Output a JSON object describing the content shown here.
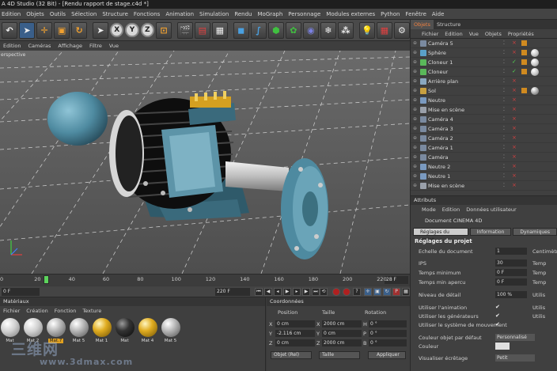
{
  "app": {
    "title": "A 4D Studio (32 Bit) - [Rendu rapport de stage.c4d *]"
  },
  "menubar": [
    "Edition",
    "Objets",
    "Outils",
    "Sélection",
    "Structure",
    "Fonctions",
    "Animation",
    "Simulation",
    "Rendu",
    "MoGraph",
    "Personnage",
    "Modules externes",
    "Python",
    "Fenêtre",
    "Aide"
  ],
  "toolbar": {
    "axes": [
      "X",
      "Y",
      "Z"
    ]
  },
  "viewport": {
    "menu": [
      "Edition",
      "Caméras",
      "Affichage",
      "Filtre",
      "Vue"
    ],
    "label": "erspective"
  },
  "timeline": {
    "ticks": [
      "0",
      "20",
      "40",
      "60",
      "80",
      "100",
      "120",
      "140",
      "160",
      "180",
      "200",
      "220"
    ],
    "current_frame": "28 F",
    "start_field": "0 F",
    "end_field": "220 F"
  },
  "materials": {
    "title": "Matériaux",
    "menu": [
      "Fichier",
      "Création",
      "Fonction",
      "Texture"
    ],
    "items": [
      {
        "label": "Mat",
        "kind": "white"
      },
      {
        "label": "Mat 2",
        "kind": "white"
      },
      {
        "label": "Mat.7",
        "kind": "grey"
      },
      {
        "label": "Mat 5",
        "kind": "grey"
      },
      {
        "label": "Mat 1",
        "kind": "gold"
      },
      {
        "label": "Mat",
        "kind": "black"
      },
      {
        "label": "Mat 4",
        "kind": "gold"
      },
      {
        "label": "Mat 5",
        "kind": "grey"
      }
    ]
  },
  "coords": {
    "title": "Coordonnées",
    "headers": [
      "Position",
      "Taille",
      "Rotation"
    ],
    "rows": [
      {
        "axis": "X",
        "pos": "0 cm",
        "size_axis": "X",
        "size": "2000 cm",
        "rot_axis": "H",
        "rot": "0 °"
      },
      {
        "axis": "Y",
        "pos": "-2.116 cm",
        "size_axis": "Y",
        "size": "0 cm",
        "rot_axis": "P",
        "rot": "0 °"
      },
      {
        "axis": "Z",
        "pos": "0 cm",
        "size_axis": "Z",
        "size": "2000 cm",
        "rot_axis": "B",
        "rot": "0 °"
      }
    ],
    "mode_select": "Objet (Rel)",
    "size_select": "Taille",
    "apply_button": "Appliquer"
  },
  "objects": {
    "tabs": [
      "Objets",
      "Structure"
    ],
    "menu": [
      "Fichier",
      "Edition",
      "Vue",
      "Objets",
      "Propriétés"
    ],
    "rows": [
      {
        "name": "Caméra 5",
        "color": "#7a8aa0",
        "check": ""
      },
      {
        "name": "Sphère",
        "color": "#5aa0c8",
        "check": ""
      },
      {
        "name": "Cloneur 1",
        "color": "#5ab85a",
        "check": "✓"
      },
      {
        "name": "Cloneur",
        "color": "#5ab85a",
        "check": "✓"
      },
      {
        "name": "Arrière plan",
        "color": "#8aa8c0",
        "check": ""
      },
      {
        "name": "Sol",
        "color": "#c8a040",
        "check": ""
      },
      {
        "name": "Neutre",
        "color": "#7a9ac0",
        "check": ""
      },
      {
        "name": "Mise en scène",
        "color": "#9aa0aa",
        "check": ""
      },
      {
        "name": "Caméra 4",
        "color": "#7a8aa0",
        "check": ""
      },
      {
        "name": "Caméra 3",
        "color": "#7a8aa0",
        "check": ""
      },
      {
        "name": "Caméra 2",
        "color": "#7a8aa0",
        "check": ""
      },
      {
        "name": "Caméra 1",
        "color": "#7a8aa0",
        "check": ""
      },
      {
        "name": "Caméra",
        "color": "#7a8aa0",
        "check": ""
      },
      {
        "name": "Neutre 2",
        "color": "#7a9ac0",
        "check": ""
      },
      {
        "name": "Neutre 1",
        "color": "#7a9ac0",
        "check": ""
      },
      {
        "name": "Mise en scène",
        "color": "#9aa0aa",
        "check": ""
      }
    ]
  },
  "attributes": {
    "title": "Attributs",
    "menu": [
      "Mode",
      "Edition",
      "Données utilisateur"
    ],
    "doc_label": "Document CINEMA 4D",
    "tabs": [
      "Réglages du projet",
      "Information",
      "Dynamiques"
    ],
    "section": "Réglages du projet",
    "fields": [
      {
        "label": "Echelle du document",
        "value": "1",
        "right": "Centimètres"
      },
      {
        "label": "IPS",
        "value": "30",
        "right": "Temp"
      },
      {
        "label": "Temps minimum",
        "value": "0 F",
        "right": "Temp"
      },
      {
        "label": "Temps min apercu",
        "value": "0 F",
        "right": "Temp"
      },
      {
        "label": "Niveau de détail",
        "value": "100 %",
        "right": "Utilis"
      }
    ],
    "checks": [
      {
        "label": "Utiliser l'animation",
        "right": "Utilis"
      },
      {
        "label": "Utiliser les générateurs",
        "right": "Utilis"
      },
      {
        "label": "Utiliser le système de mouvement",
        "right": ""
      }
    ],
    "color_label": "Couleur objet par défaut",
    "color_value": "Personnalisé",
    "couleur_label": "Couleur",
    "viz_label": "Visualiser écrêtage",
    "viz_value": "Petit"
  },
  "watermark": {
    "line1": "三维网",
    "line2": "www.3dmax.com"
  }
}
